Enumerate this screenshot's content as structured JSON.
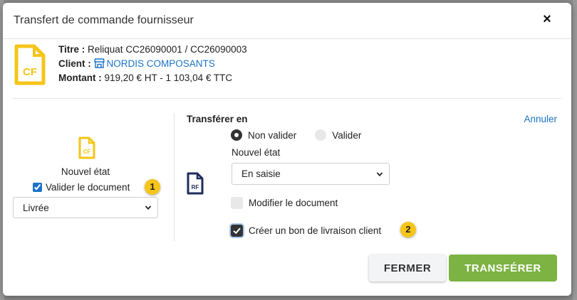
{
  "modal": {
    "title": "Transfert de commande fournisseur",
    "close_icon": "close-icon"
  },
  "info": {
    "doc_icon_text": "CF",
    "title_label": "Titre :",
    "title_value": "Reliquat CC26090001 / CC26090003",
    "client_label": "Client :",
    "client_value": "NORDIS COMPOSANTS",
    "amount_label": "Montant :",
    "amount_value": "919,20 € HT - 1 103,04 € TTC"
  },
  "left": {
    "doc_icon_text": "CF",
    "state_label": "Nouvel état",
    "validate_label": "Valider le document",
    "validate_checked": true,
    "badge": "1",
    "select_value": "Livrée"
  },
  "right": {
    "title": "Transférer en",
    "cancel_label": "Annuler",
    "doc_icon_text": "RF",
    "radio_non_valider": "Non valider",
    "radio_valider": "Valider",
    "selected_radio": "Non valider",
    "state_label": "Nouvel état",
    "select_value": "En saisie",
    "modify_label": "Modifier le document",
    "create_delivery_label": "Créer un bon de livraison client",
    "create_delivery_checked": true,
    "badge": "2"
  },
  "buttons": {
    "close_label": "FERMER",
    "transfer_label": "TRANSFÉRER"
  },
  "colors": {
    "accent_yellow": "#f5c518",
    "link_blue": "#1a73c8",
    "primary_green": "#7cb342",
    "navy_icon": "#1f2d5c"
  }
}
